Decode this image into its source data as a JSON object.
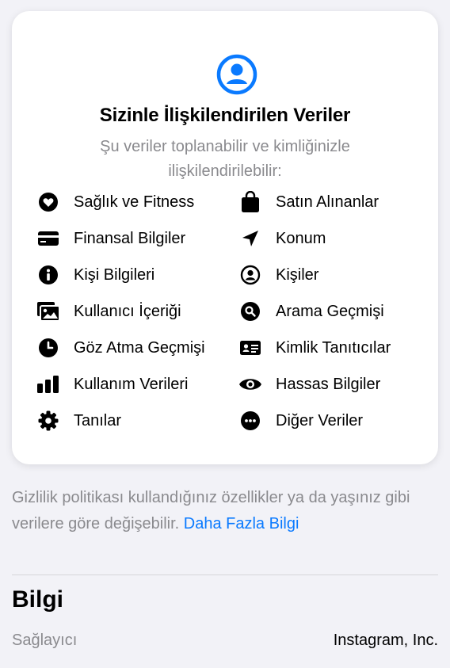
{
  "card": {
    "title": "Sizinle İlişkilendirilen Veriler",
    "subtitle": "Şu veriler toplanabilir ve kimliğinizle ilişkilendirilebilir:",
    "accent_color": "#0a7aff",
    "icon": "person-circle-icon",
    "items_left": [
      {
        "label": "Sağlık ve Fitness",
        "icon": "heart-icon"
      },
      {
        "label": "Finansal Bilgiler",
        "icon": "credit-card-icon"
      },
      {
        "label": "Kişi Bilgileri",
        "icon": "info-icon"
      },
      {
        "label": "Kullanıcı İçeriği",
        "icon": "photos-icon"
      },
      {
        "label": "Göz Atma Geçmişi",
        "icon": "clock-icon"
      },
      {
        "label": "Kullanım Verileri",
        "icon": "bar-chart-icon"
      },
      {
        "label": "Tanılar",
        "icon": "gear-icon"
      }
    ],
    "items_right": [
      {
        "label": "Satın Alınanlar",
        "icon": "shopping-bag-icon"
      },
      {
        "label": "Konum",
        "icon": "location-arrow-icon"
      },
      {
        "label": "Kişiler",
        "icon": "contact-circle-icon"
      },
      {
        "label": "Arama Geçmişi",
        "icon": "search-icon"
      },
      {
        "label": "Kimlik Tanıtıcılar",
        "icon": "id-card-icon"
      },
      {
        "label": "Hassas Bilgiler",
        "icon": "eye-icon"
      },
      {
        "label": "Diğer Veriler",
        "icon": "more-icon"
      }
    ]
  },
  "footnote": {
    "text": "Gizlilik politikası kullandığınız özellikler ya da yaşınız gibi verilere göre değişebilir. ",
    "link": "Daha Fazla Bilgi"
  },
  "info": {
    "title": "Bilgi",
    "provider_label": "Sağlayıcı",
    "provider_value": "Instagram, Inc."
  }
}
